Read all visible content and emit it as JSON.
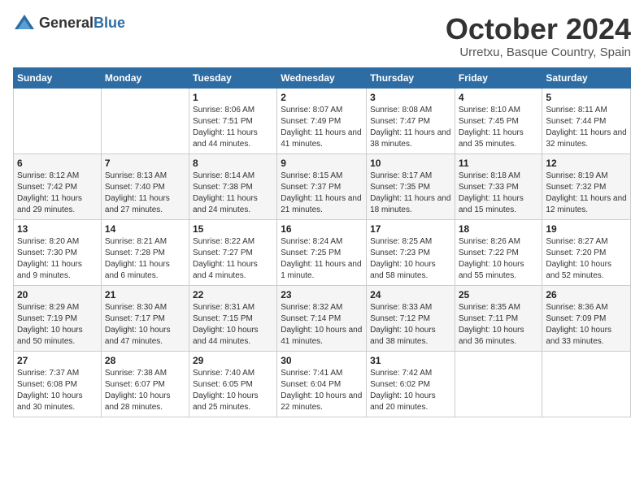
{
  "logo": {
    "text_general": "General",
    "text_blue": "Blue"
  },
  "header": {
    "month_title": "October 2024",
    "location": "Urretxu, Basque Country, Spain"
  },
  "days_of_week": [
    "Sunday",
    "Monday",
    "Tuesday",
    "Wednesday",
    "Thursday",
    "Friday",
    "Saturday"
  ],
  "weeks": [
    [
      {
        "day": "",
        "sunrise": "",
        "sunset": "",
        "daylight": ""
      },
      {
        "day": "",
        "sunrise": "",
        "sunset": "",
        "daylight": ""
      },
      {
        "day": "1",
        "sunrise": "Sunrise: 8:06 AM",
        "sunset": "Sunset: 7:51 PM",
        "daylight": "Daylight: 11 hours and 44 minutes."
      },
      {
        "day": "2",
        "sunrise": "Sunrise: 8:07 AM",
        "sunset": "Sunset: 7:49 PM",
        "daylight": "Daylight: 11 hours and 41 minutes."
      },
      {
        "day": "3",
        "sunrise": "Sunrise: 8:08 AM",
        "sunset": "Sunset: 7:47 PM",
        "daylight": "Daylight: 11 hours and 38 minutes."
      },
      {
        "day": "4",
        "sunrise": "Sunrise: 8:10 AM",
        "sunset": "Sunset: 7:45 PM",
        "daylight": "Daylight: 11 hours and 35 minutes."
      },
      {
        "day": "5",
        "sunrise": "Sunrise: 8:11 AM",
        "sunset": "Sunset: 7:44 PM",
        "daylight": "Daylight: 11 hours and 32 minutes."
      }
    ],
    [
      {
        "day": "6",
        "sunrise": "Sunrise: 8:12 AM",
        "sunset": "Sunset: 7:42 PM",
        "daylight": "Daylight: 11 hours and 29 minutes."
      },
      {
        "day": "7",
        "sunrise": "Sunrise: 8:13 AM",
        "sunset": "Sunset: 7:40 PM",
        "daylight": "Daylight: 11 hours and 27 minutes."
      },
      {
        "day": "8",
        "sunrise": "Sunrise: 8:14 AM",
        "sunset": "Sunset: 7:38 PM",
        "daylight": "Daylight: 11 hours and 24 minutes."
      },
      {
        "day": "9",
        "sunrise": "Sunrise: 8:15 AM",
        "sunset": "Sunset: 7:37 PM",
        "daylight": "Daylight: 11 hours and 21 minutes."
      },
      {
        "day": "10",
        "sunrise": "Sunrise: 8:17 AM",
        "sunset": "Sunset: 7:35 PM",
        "daylight": "Daylight: 11 hours and 18 minutes."
      },
      {
        "day": "11",
        "sunrise": "Sunrise: 8:18 AM",
        "sunset": "Sunset: 7:33 PM",
        "daylight": "Daylight: 11 hours and 15 minutes."
      },
      {
        "day": "12",
        "sunrise": "Sunrise: 8:19 AM",
        "sunset": "Sunset: 7:32 PM",
        "daylight": "Daylight: 11 hours and 12 minutes."
      }
    ],
    [
      {
        "day": "13",
        "sunrise": "Sunrise: 8:20 AM",
        "sunset": "Sunset: 7:30 PM",
        "daylight": "Daylight: 11 hours and 9 minutes."
      },
      {
        "day": "14",
        "sunrise": "Sunrise: 8:21 AM",
        "sunset": "Sunset: 7:28 PM",
        "daylight": "Daylight: 11 hours and 6 minutes."
      },
      {
        "day": "15",
        "sunrise": "Sunrise: 8:22 AM",
        "sunset": "Sunset: 7:27 PM",
        "daylight": "Daylight: 11 hours and 4 minutes."
      },
      {
        "day": "16",
        "sunrise": "Sunrise: 8:24 AM",
        "sunset": "Sunset: 7:25 PM",
        "daylight": "Daylight: 11 hours and 1 minute."
      },
      {
        "day": "17",
        "sunrise": "Sunrise: 8:25 AM",
        "sunset": "Sunset: 7:23 PM",
        "daylight": "Daylight: 10 hours and 58 minutes."
      },
      {
        "day": "18",
        "sunrise": "Sunrise: 8:26 AM",
        "sunset": "Sunset: 7:22 PM",
        "daylight": "Daylight: 10 hours and 55 minutes."
      },
      {
        "day": "19",
        "sunrise": "Sunrise: 8:27 AM",
        "sunset": "Sunset: 7:20 PM",
        "daylight": "Daylight: 10 hours and 52 minutes."
      }
    ],
    [
      {
        "day": "20",
        "sunrise": "Sunrise: 8:29 AM",
        "sunset": "Sunset: 7:19 PM",
        "daylight": "Daylight: 10 hours and 50 minutes."
      },
      {
        "day": "21",
        "sunrise": "Sunrise: 8:30 AM",
        "sunset": "Sunset: 7:17 PM",
        "daylight": "Daylight: 10 hours and 47 minutes."
      },
      {
        "day": "22",
        "sunrise": "Sunrise: 8:31 AM",
        "sunset": "Sunset: 7:15 PM",
        "daylight": "Daylight: 10 hours and 44 minutes."
      },
      {
        "day": "23",
        "sunrise": "Sunrise: 8:32 AM",
        "sunset": "Sunset: 7:14 PM",
        "daylight": "Daylight: 10 hours and 41 minutes."
      },
      {
        "day": "24",
        "sunrise": "Sunrise: 8:33 AM",
        "sunset": "Sunset: 7:12 PM",
        "daylight": "Daylight: 10 hours and 38 minutes."
      },
      {
        "day": "25",
        "sunrise": "Sunrise: 8:35 AM",
        "sunset": "Sunset: 7:11 PM",
        "daylight": "Daylight: 10 hours and 36 minutes."
      },
      {
        "day": "26",
        "sunrise": "Sunrise: 8:36 AM",
        "sunset": "Sunset: 7:09 PM",
        "daylight": "Daylight: 10 hours and 33 minutes."
      }
    ],
    [
      {
        "day": "27",
        "sunrise": "Sunrise: 7:37 AM",
        "sunset": "Sunset: 6:08 PM",
        "daylight": "Daylight: 10 hours and 30 minutes."
      },
      {
        "day": "28",
        "sunrise": "Sunrise: 7:38 AM",
        "sunset": "Sunset: 6:07 PM",
        "daylight": "Daylight: 10 hours and 28 minutes."
      },
      {
        "day": "29",
        "sunrise": "Sunrise: 7:40 AM",
        "sunset": "Sunset: 6:05 PM",
        "daylight": "Daylight: 10 hours and 25 minutes."
      },
      {
        "day": "30",
        "sunrise": "Sunrise: 7:41 AM",
        "sunset": "Sunset: 6:04 PM",
        "daylight": "Daylight: 10 hours and 22 minutes."
      },
      {
        "day": "31",
        "sunrise": "Sunrise: 7:42 AM",
        "sunset": "Sunset: 6:02 PM",
        "daylight": "Daylight: 10 hours and 20 minutes."
      },
      {
        "day": "",
        "sunrise": "",
        "sunset": "",
        "daylight": ""
      },
      {
        "day": "",
        "sunrise": "",
        "sunset": "",
        "daylight": ""
      }
    ]
  ]
}
